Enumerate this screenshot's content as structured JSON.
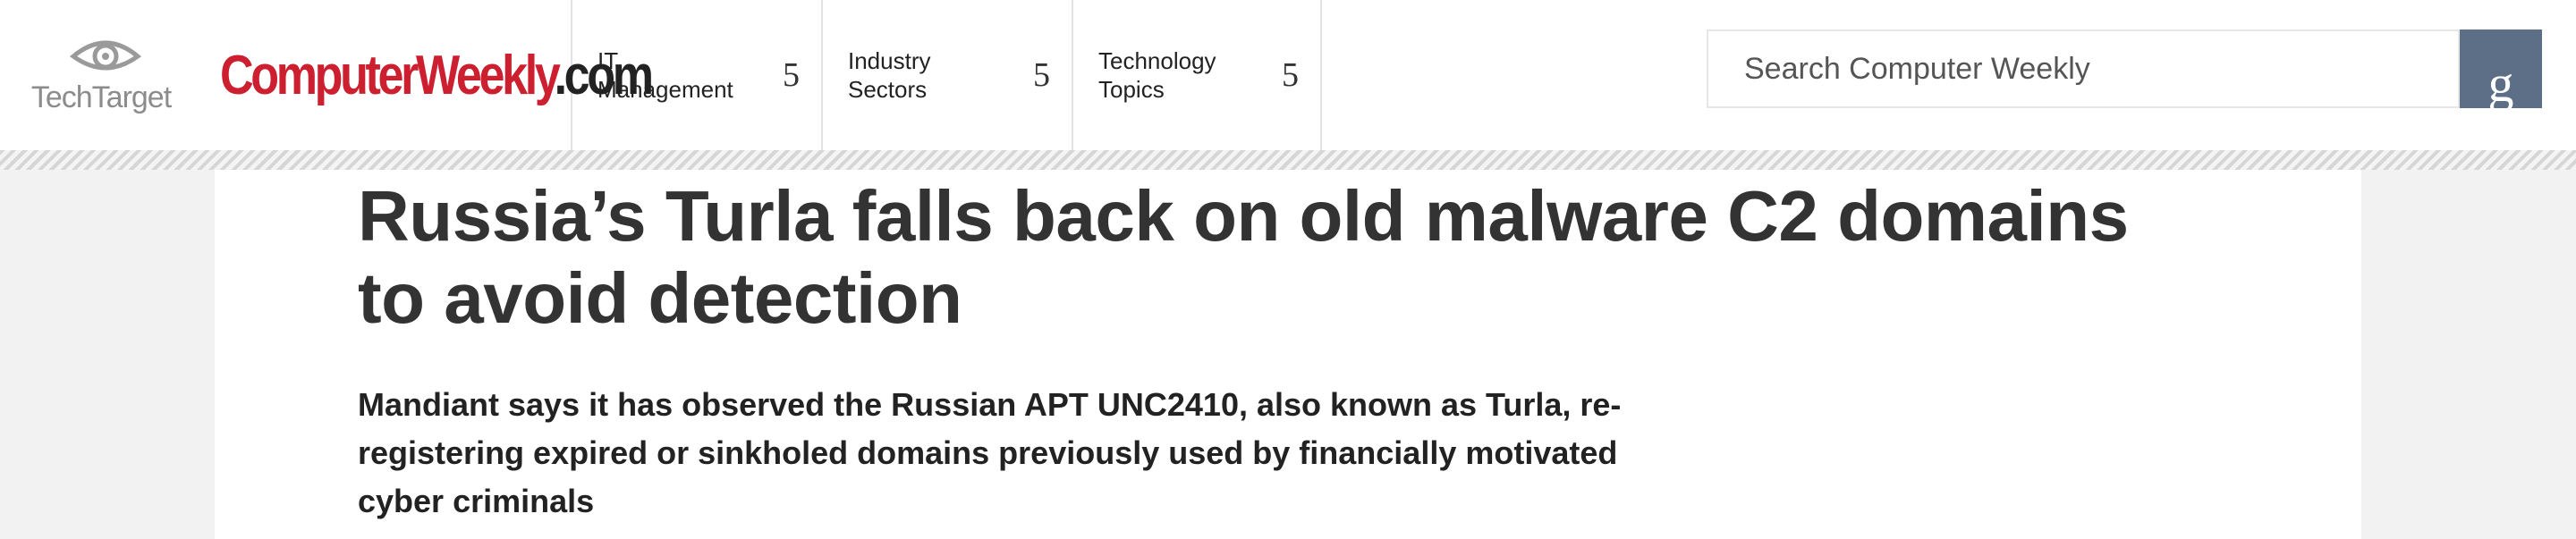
{
  "brand": {
    "techtarget_logo_text": "TechTarget",
    "site_logo_red": "ComputerWeekly",
    "site_logo_suffix": ".com"
  },
  "nav": {
    "items": [
      {
        "label": "IT Management",
        "chevron": "5"
      },
      {
        "label": "Industry Sectors",
        "chevron": "5"
      },
      {
        "label": "Technology Topics",
        "chevron": "5"
      }
    ]
  },
  "search": {
    "placeholder": "Search Computer Weekly",
    "button_glyph": "g",
    "button_icon": "search-icon"
  },
  "article": {
    "headline": "Russia’s Turla falls back on old malware C2 domains to avoid detection",
    "dek": "Mandiant says it has observed the Russian APT UNC2410, also known as Turla, re-registering expired or sinkholed domains previously used by financially motivated cyber criminals"
  },
  "colors": {
    "brand_red": "#cc1f2f",
    "search_button": "#5d6f87",
    "page_background": "#f2f2f2"
  }
}
